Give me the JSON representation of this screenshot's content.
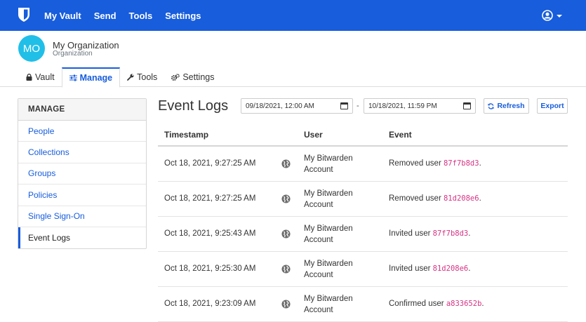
{
  "topnav": {
    "links": [
      "My Vault",
      "Send",
      "Tools",
      "Settings"
    ],
    "brand_color": "#175ddc"
  },
  "org": {
    "initials": "MO",
    "name": "My Organization",
    "type": "Organization",
    "avatar_color": "#20bfe8"
  },
  "tabs": [
    {
      "label": "Vault",
      "icon": "lock-icon"
    },
    {
      "label": "Manage",
      "icon": "sliders-icon",
      "active": true
    },
    {
      "label": "Tools",
      "icon": "wrench-icon"
    },
    {
      "label": "Settings",
      "icon": "gears-icon"
    }
  ],
  "sidebar": {
    "heading": "MANAGE",
    "items": [
      {
        "label": "People"
      },
      {
        "label": "Collections"
      },
      {
        "label": "Groups"
      },
      {
        "label": "Policies"
      },
      {
        "label": "Single Sign-On"
      },
      {
        "label": "Event Logs",
        "active": true
      }
    ]
  },
  "main": {
    "title": "Event Logs",
    "start_date": "09/18/2021, 12:00 AM",
    "separator": "-",
    "end_date": "10/18/2021, 11:59 PM",
    "refresh_label": "Refresh",
    "export_label": "Export"
  },
  "table": {
    "headers": {
      "timestamp": "Timestamp",
      "user": "User",
      "event": "Event"
    },
    "rows": [
      {
        "timestamp": "Oct 18, 2021, 9:27:25 AM",
        "user_line1": "My Bitwarden",
        "user_line2": "Account",
        "event_text": "Removed user ",
        "event_code": "87f7b8d3",
        "event_end": "."
      },
      {
        "timestamp": "Oct 18, 2021, 9:27:25 AM",
        "user_line1": "My Bitwarden",
        "user_line2": "Account",
        "event_text": "Removed user ",
        "event_code": "81d208e6",
        "event_end": "."
      },
      {
        "timestamp": "Oct 18, 2021, 9:25:43 AM",
        "user_line1": "My Bitwarden",
        "user_line2": "Account",
        "event_text": "Invited user ",
        "event_code": "87f7b8d3",
        "event_end": "."
      },
      {
        "timestamp": "Oct 18, 2021, 9:25:30 AM",
        "user_line1": "My Bitwarden",
        "user_line2": "Account",
        "event_text": "Invited user ",
        "event_code": "81d208e6",
        "event_end": "."
      },
      {
        "timestamp": "Oct 18, 2021, 9:23:09 AM",
        "user_line1": "My Bitwarden",
        "user_line2": "Account",
        "event_text": "Confirmed user ",
        "event_code": "a833652b",
        "event_end": "."
      }
    ]
  }
}
